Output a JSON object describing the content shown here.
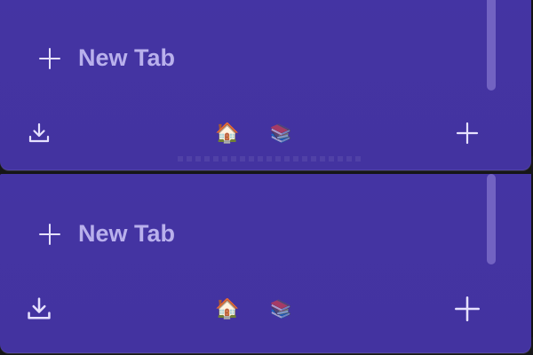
{
  "panels": [
    {
      "new_tab_label": "New Tab",
      "icons": {
        "download": "download-icon",
        "home": "🏠",
        "books": "📚",
        "add": "plus-icon"
      }
    },
    {
      "new_tab_label": "New Tab",
      "icons": {
        "download": "download-icon",
        "home": "🏠",
        "books": "📚",
        "add": "plus-icon"
      }
    }
  ],
  "colors": {
    "panel_bg": "#4434a3",
    "label_text": "#b9b0ec",
    "icon_stroke": "#e6e1ff",
    "scrollbar": "#7a6cc8"
  }
}
